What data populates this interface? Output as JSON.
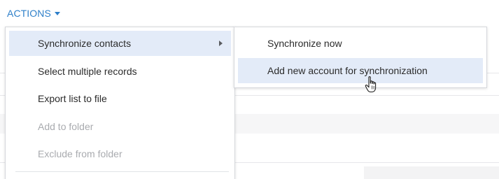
{
  "actions": {
    "label": "ACTIONS",
    "caret_icon": "caret-down-icon"
  },
  "menu": {
    "items": [
      {
        "label": "Synchronize contacts",
        "state": "highlighted",
        "has_submenu": true
      },
      {
        "label": "Select multiple records",
        "state": "normal"
      },
      {
        "label": "Export list to file",
        "state": "normal"
      },
      {
        "label": "Add to folder",
        "state": "disabled"
      },
      {
        "label": "Exclude from folder",
        "state": "disabled"
      }
    ],
    "submenu_arrow_icon": "chevron-right-icon"
  },
  "submenu": {
    "items": [
      {
        "label": "Synchronize now",
        "state": "normal"
      },
      {
        "label": "Add new account for synchronization",
        "state": "highlighted"
      }
    ]
  },
  "cursor": {
    "icon": "hand-pointer-icon"
  },
  "colors": {
    "accent": "#2d7fc9",
    "highlight": "#e3ebf8",
    "text": "#2b2b2b",
    "disabled_text": "#a9abaf"
  }
}
